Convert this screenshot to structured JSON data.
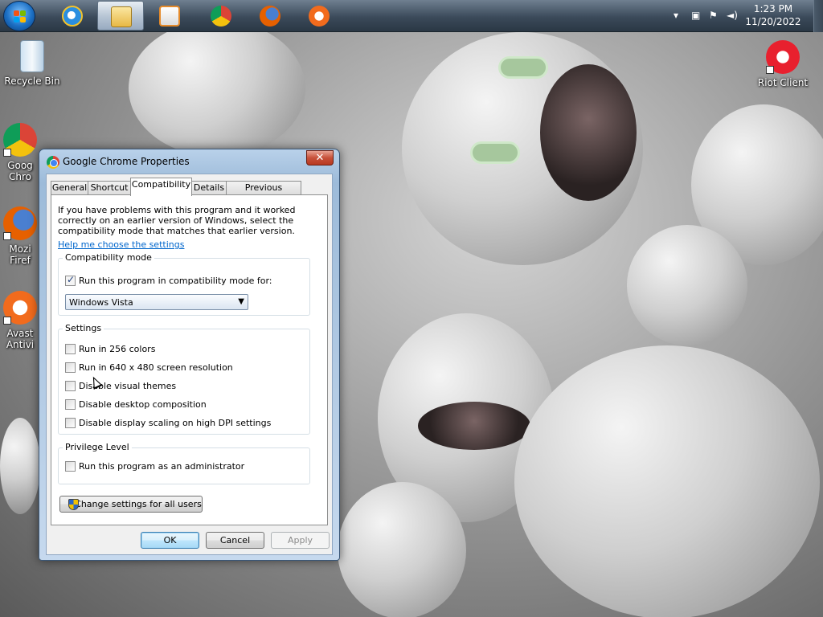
{
  "taskbar": {
    "apps": [
      {
        "name": "internet-explorer-icon",
        "color": "#2a8ee0"
      },
      {
        "name": "windows-explorer-icon",
        "color": "#f1c94b"
      },
      {
        "name": "media-player-icon",
        "color": "#e58a2a"
      },
      {
        "name": "chrome-icon",
        "color": "#db4437"
      },
      {
        "name": "firefox-icon",
        "color": "#e66000"
      },
      {
        "name": "avast-icon",
        "color": "#f26b1d"
      }
    ],
    "clock": {
      "time": "1:23 PM",
      "date": "11/20/2022"
    },
    "tray_icons": [
      "chevron-up-icon",
      "network-icon",
      "action-center-icon",
      "volume-icon"
    ]
  },
  "desktop": {
    "icons": [
      {
        "label": "Recycle Bin",
        "icon": "recycle-bin-icon"
      },
      {
        "label": "Goog\nChro",
        "icon": "chrome-shortcut-icon"
      },
      {
        "label": "Mozi\nFiref",
        "icon": "firefox-shortcut-icon"
      },
      {
        "label": "Avast\nAntivi",
        "icon": "avast-shortcut-icon"
      },
      {
        "label": "Riot Client",
        "icon": "riot-client-icon"
      }
    ]
  },
  "dialog": {
    "title": "Google Chrome Properties",
    "close_glyph": "✕",
    "tabs": [
      "General",
      "Shortcut",
      "Compatibility",
      "Details",
      "Previous Versions"
    ],
    "active_tab": "Compatibility",
    "intro": "If you have problems with this program and it worked correctly on an earlier version of Windows, select the compatibility mode that matches that earlier version.",
    "help_link": "Help me choose the settings",
    "compat_group": {
      "legend": "Compatibility mode",
      "checkbox_label": "Run this program in compatibility mode for:",
      "checked": true,
      "select_value": "Windows Vista",
      "select_arrow": "▼"
    },
    "settings_group": {
      "legend": "Settings",
      "items": [
        {
          "label": "Run in 256 colors",
          "checked": false
        },
        {
          "label": "Run in 640 x 480 screen resolution",
          "checked": false
        },
        {
          "label": "Disable visual themes",
          "checked": false
        },
        {
          "label": "Disable desktop composition",
          "checked": false
        },
        {
          "label": "Disable display scaling on high DPI settings",
          "checked": false
        }
      ]
    },
    "privilege_group": {
      "legend": "Privilege Level",
      "items": [
        {
          "label": "Run this program as an administrator",
          "checked": false
        }
      ]
    },
    "change_all_users": "Change settings for all users",
    "buttons": {
      "ok": "OK",
      "cancel": "Cancel",
      "apply": "Apply"
    }
  }
}
